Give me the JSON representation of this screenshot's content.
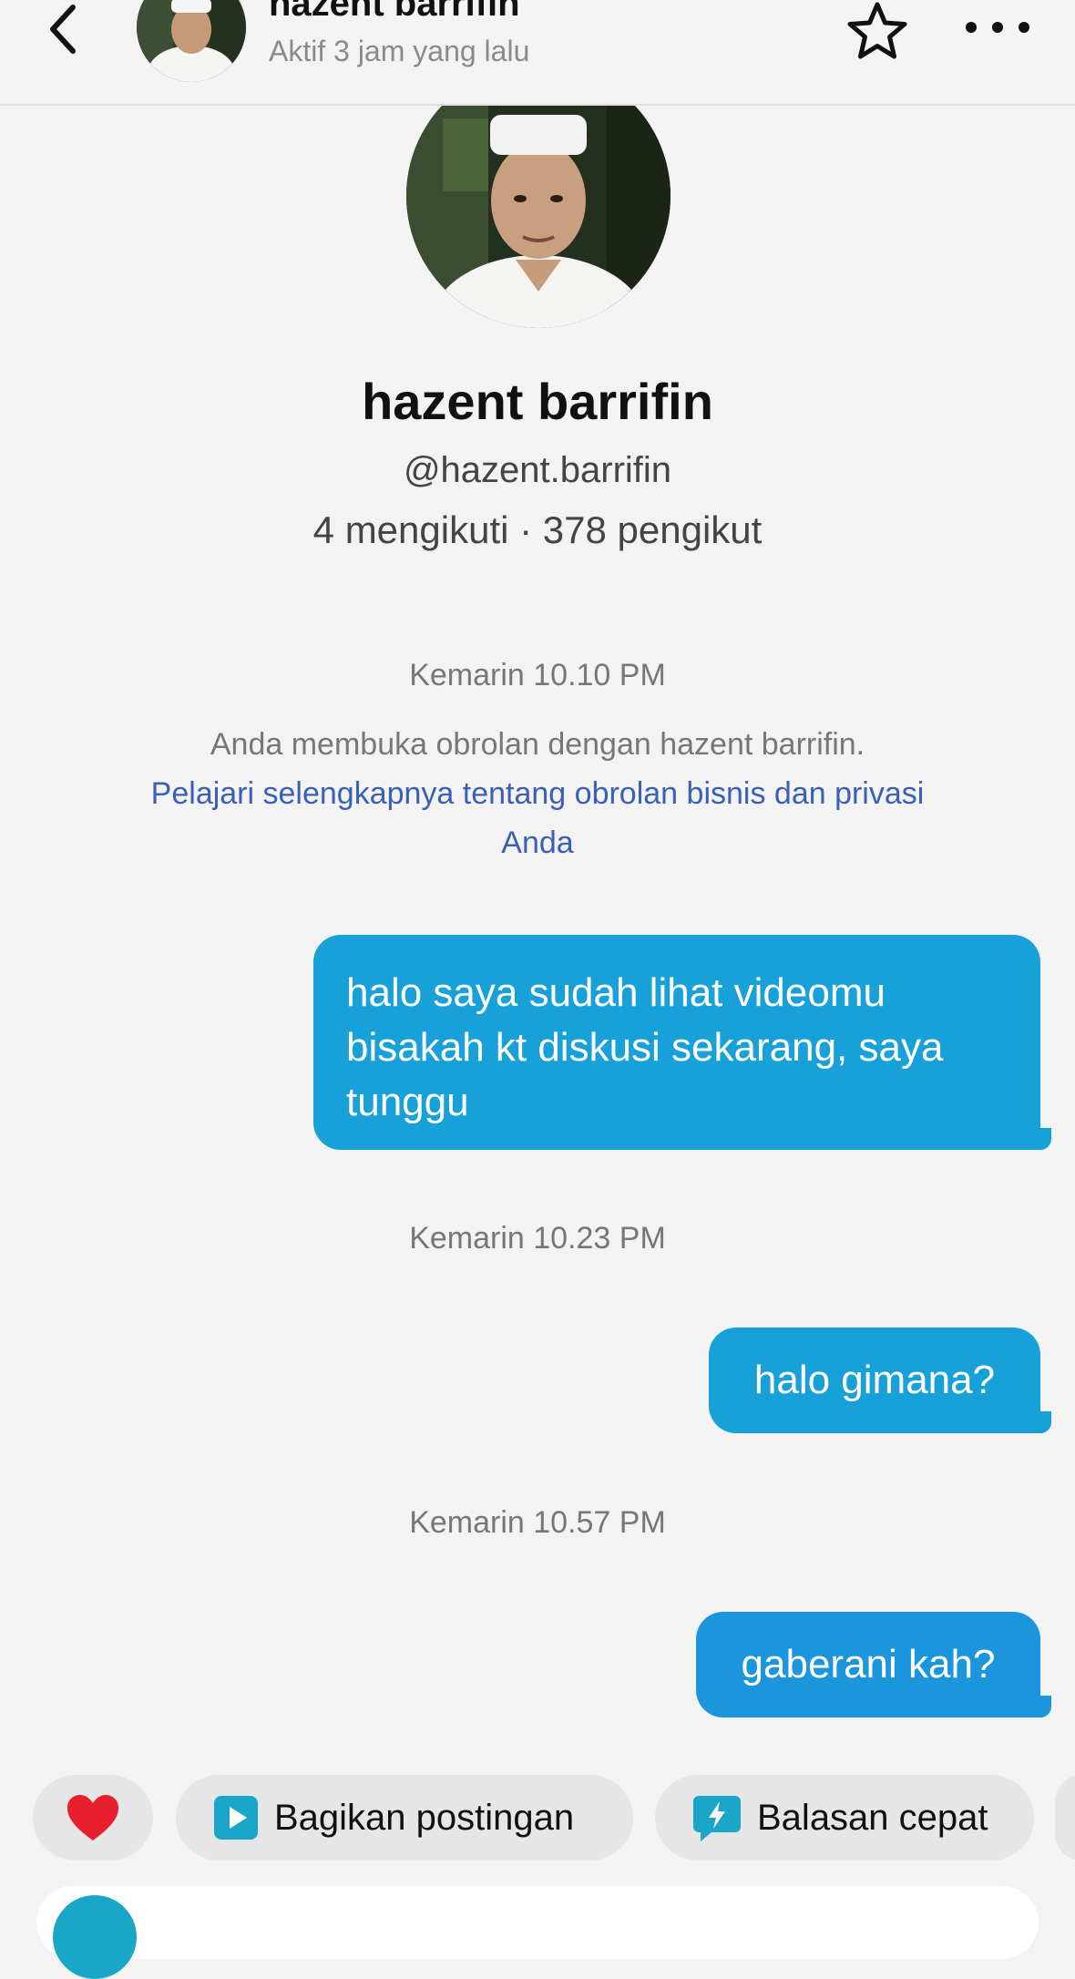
{
  "header": {
    "name": "hazent barrifin",
    "status": "Aktif 3 jam yang lalu"
  },
  "profile": {
    "name": "hazent barrifin",
    "handle": "@hazent.barrifin",
    "stats": "4 mengikuti · 378 pengikut"
  },
  "chat": {
    "timestamp_1": "Kemarin 10.10 PM",
    "notice_text": "Anda membuka obrolan dengan hazent barrifin.",
    "notice_link": "Pelajari selengkapnya tentang obrolan bisnis dan privasi Anda",
    "messages": [
      {
        "text": "halo saya sudah lihat videomu bisakah kt diskusi sekarang, saya tunggu"
      },
      {
        "text": "halo gimana?"
      },
      {
        "text": "gaberani kah?"
      }
    ],
    "timestamp_2": "Kemarin 10.23 PM",
    "timestamp_3": "Kemarin 10.57 PM"
  },
  "quick_actions": {
    "share_post": "Bagikan postingan",
    "quick_reply": "Balasan cepat"
  },
  "colors": {
    "bubble": "#18a1d9",
    "link": "#3b5fb5",
    "heart": "#e8202e"
  }
}
